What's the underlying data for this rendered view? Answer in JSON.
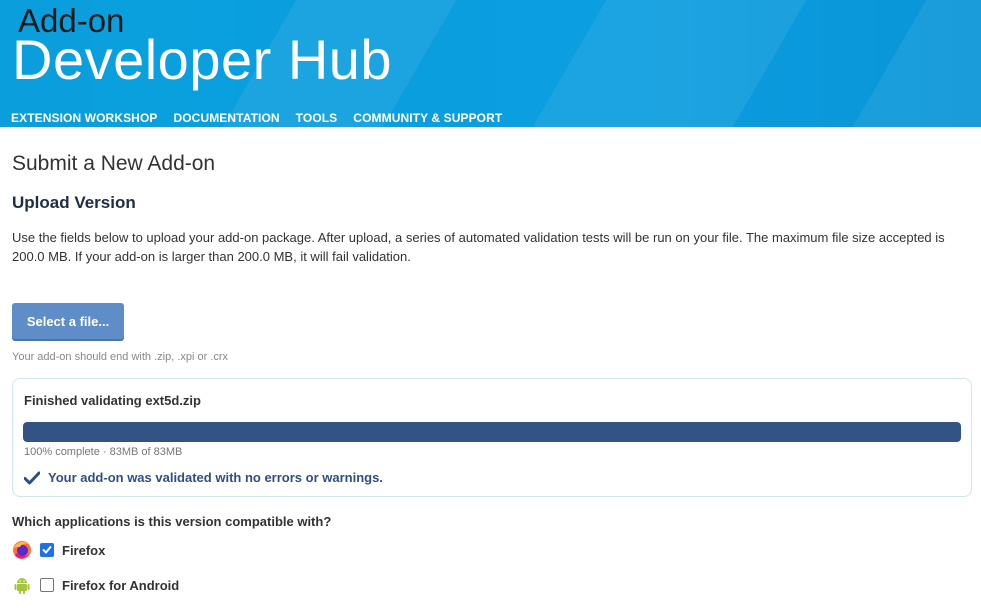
{
  "header": {
    "brand_line1": "Add-on",
    "brand_line2": "Developer Hub",
    "nav": [
      {
        "label": "EXTENSION WORKSHOP"
      },
      {
        "label": "DOCUMENTATION"
      },
      {
        "label": "TOOLS"
      },
      {
        "label": "COMMUNITY & SUPPORT"
      }
    ]
  },
  "page": {
    "title": "Submit a New Add-on",
    "section_title": "Upload Version",
    "intro": "Use the fields below to upload your add-on package. After upload, a series of automated validation tests will be run on your file. The maximum file size accepted is 200.0 MB. If your add-on is larger than 200.0 MB, it will fail validation."
  },
  "upload": {
    "button_label": "Select a file...",
    "hint": "Your add-on should end with .zip, .xpi or .crx"
  },
  "validation": {
    "title": "Finished validating ext5d.zip",
    "progress_percent": 100,
    "progress_text": "100% complete · 83MB of 83MB",
    "success_message": "Your add-on was validated with no errors or warnings."
  },
  "compatibility": {
    "question": "Which applications is this version compatible with?",
    "apps": [
      {
        "label": "Firefox",
        "checked": true,
        "icon": "firefox-icon"
      },
      {
        "label": "Firefox for Android",
        "checked": false,
        "icon": "android-icon"
      }
    ]
  },
  "colors": {
    "header_bg": "#0a9fdc",
    "button_bg": "#5f8dc8",
    "progress_fill": "#345385",
    "success_text": "#2e4f86",
    "checkbox_checked": "#1a73e8"
  }
}
